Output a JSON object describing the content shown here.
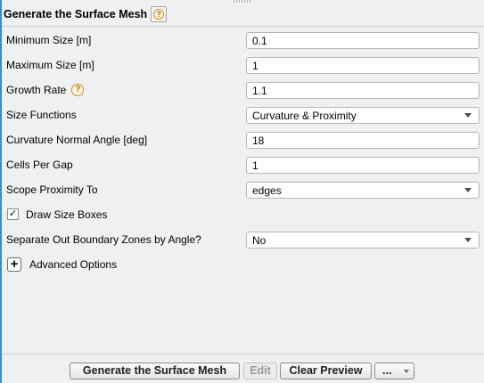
{
  "panel": {
    "title": "Generate the Surface Mesh",
    "help_symbol": "?"
  },
  "fields": {
    "min_size": {
      "label": "Minimum Size [m]",
      "value": "0.1"
    },
    "max_size": {
      "label": "Maximum Size [m]",
      "value": "1"
    },
    "growth_rate": {
      "label": "Growth Rate",
      "value": "1.1"
    },
    "size_functions": {
      "label": "Size Functions",
      "value": "Curvature & Proximity"
    },
    "curvature_angle": {
      "label": "Curvature Normal Angle [deg]",
      "value": "18"
    },
    "cells_per_gap": {
      "label": "Cells Per Gap",
      "value": "1"
    },
    "scope_proximity": {
      "label": "Scope Proximity To",
      "value": "edges"
    },
    "draw_size_boxes": {
      "label": "Draw Size Boxes",
      "checked": true,
      "check_symbol": "✓"
    },
    "separate_zones": {
      "label": "Separate Out Boundary Zones by Angle?",
      "value": "No"
    },
    "advanced_options": {
      "label": "Advanced Options",
      "expand_symbol": "+"
    }
  },
  "buttons": {
    "generate": "Generate the Surface Mesh",
    "edit": "Edit",
    "clear_preview": "Clear Preview",
    "more": "..."
  },
  "icons": {
    "help": "help-icon",
    "dropdown": "chevron-down-icon",
    "expand": "plus-icon",
    "check": "checkmark-icon"
  },
  "colors": {
    "accent": "#2d8fe0",
    "help_icon": "#d58a14",
    "background": "#f0f0f0"
  }
}
